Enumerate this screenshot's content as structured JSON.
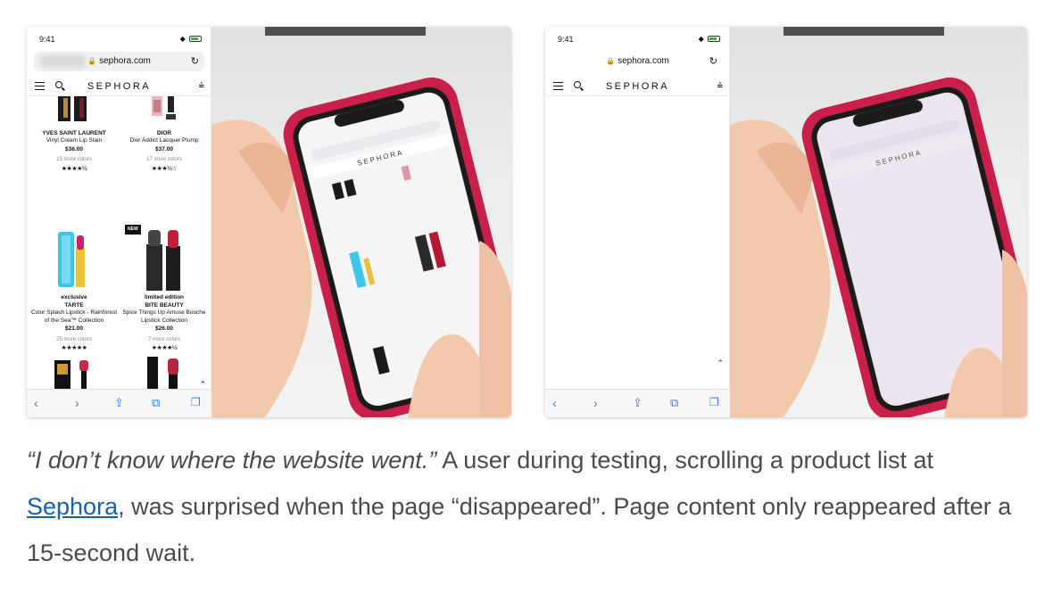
{
  "left": {
    "status_time": "9:41",
    "url": "sephora.com",
    "brand": "SEPHORA",
    "products": [
      {
        "brand": "YVES SAINT LAURENT",
        "name": "Vinyl Cream Lip Stain",
        "price": "$36.00",
        "colors": "15 more colors",
        "stars": "★★★★½"
      },
      {
        "brand": "DIOR",
        "name": "Dior Addict Lacquer Plump",
        "price": "$37.00",
        "colors": "17 more colors",
        "stars": "★★★½☆"
      },
      {
        "tag": "exclusive",
        "brand": "TARTE",
        "name": "Color Splash Lipstick - Rainforest of the Sea™ Collection",
        "price": "$21.00",
        "colors": "25 more colors",
        "stars": "★★★★★"
      },
      {
        "badge": "NEW",
        "tag": "limited edition",
        "brand": "BITE BEAUTY",
        "name": "Spice Things Up Amuse Bouche Lipstick Collection",
        "price": "$26.00",
        "colors": "7 more colors",
        "stars": "★★★★½"
      }
    ]
  },
  "right": {
    "status_time": "9:41",
    "url": "sephora.com",
    "brand": "SEPHORA"
  },
  "caption": {
    "quote": "“I don’t know where the website went.”",
    "text1": " A user during testing, scrolling a product list at ",
    "link": "Sephora",
    "text2": ", was surprised when the page “disappeared”. Page content only reappeared after a 15-second wait."
  }
}
